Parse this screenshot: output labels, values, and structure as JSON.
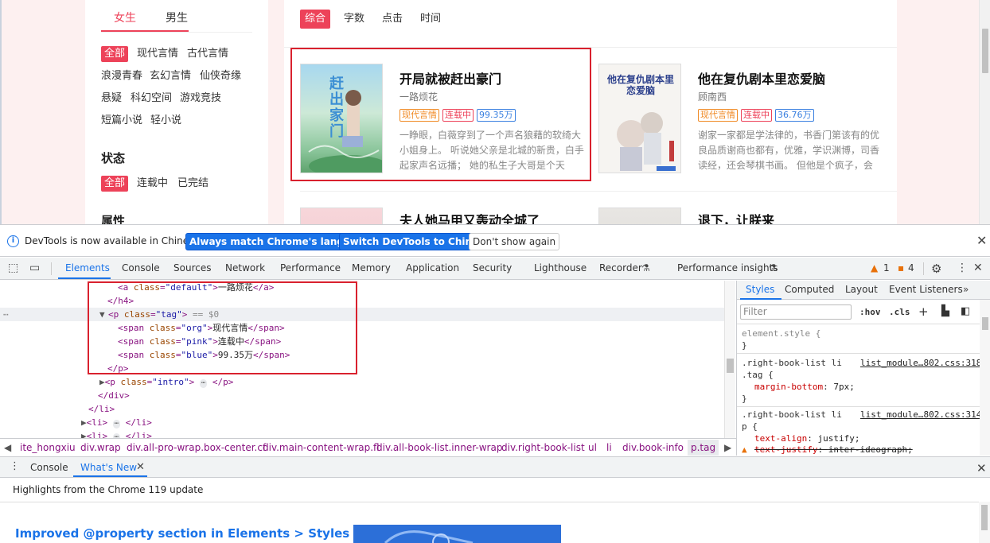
{
  "site": {
    "gender_tabs": [
      "女生",
      "男生"
    ],
    "categories": [
      "全部",
      "现代言情",
      "古代言情",
      "浪漫青春",
      "玄幻言情",
      "仙侠奇缘",
      "悬疑",
      "科幻空间",
      "游戏竞技",
      "短篇小说",
      "轻小说"
    ],
    "status_title": "状态",
    "status_options": [
      "全部",
      "连载中",
      "已完结"
    ],
    "attr_title": "属性",
    "sort_tabs": [
      "综合",
      "字数",
      "点击",
      "时间"
    ],
    "books": [
      {
        "title": "开局就被赶出豪门",
        "author": "一路烦花",
        "tags": [
          "现代言情",
          "连载中",
          "99.35万"
        ],
        "intro": "一睁眼，白薇穿到了一个声名狼藉的软绮大小姐身上。 听说她父亲是北城的新贵，白手起家声名远播； 她的私生子大哥是个天",
        "cover_text": "赶出家门"
      },
      {
        "title": "他在复仇剧本里恋爱脑",
        "author": "顾南西",
        "tags": [
          "现代言情",
          "连载中",
          "36.76万"
        ],
        "intro": "谢家一家都是学法律的，书香门第该有的优良品质谢商也都有，优雅，学识渊博，司香读经，还会琴棋书画。 但他是个疯子，会",
        "cover_text": "他在复仇剧本里恋爱脑"
      },
      {
        "title": "夫人她马甲又轰动全城了"
      },
      {
        "title": "退下，让朕来"
      }
    ]
  },
  "devtools": {
    "infobar": {
      "text": "DevTools is now available in Chinese!",
      "btn_match": "Always match Chrome's language",
      "btn_switch": "Switch DevTools to Chinese",
      "btn_dont": "Don't show again"
    },
    "tabs": [
      "Elements",
      "Console",
      "Sources",
      "Network",
      "Performance",
      "Memory",
      "Application",
      "Security",
      "Lighthouse",
      "Recorder",
      "Performance insights"
    ],
    "warnings": "1",
    "issues": "4",
    "code": {
      "l1_tag": "a",
      "l1_attr": "class",
      "l1_val": "\"default\"",
      "l1_text": "一路烦花",
      "l2": "</h4>",
      "l3_attr": "class",
      "l3_val": "\"tag\"",
      "l3_eq": "== $0",
      "spans": [
        {
          "cls": "\"org\"",
          "text": "现代言情"
        },
        {
          "cls": "\"pink\"",
          "text": "连载中"
        },
        {
          "cls": "\"blue\"",
          "text": "99.35万"
        }
      ],
      "l7": "</p>",
      "l8_val": "\"intro\"",
      "l9": "</div>",
      "l10": "</li>"
    },
    "breadcrumbs": [
      "ite_hongxiu",
      "div.wrap",
      "div.all-pro-wrap.box-center.cf",
      "div.main-content-wrap.fl",
      "div.all-book-list.inner-wrap",
      "div.right-book-list",
      "ul",
      "li",
      "div.book-info",
      "p.tag"
    ],
    "styles": {
      "tabs": [
        "Styles",
        "Computed",
        "Layout",
        "Event Listeners"
      ],
      "filter_placeholder": "Filter",
      "hov": ":hov",
      "cls": ".cls",
      "element_style": "element.style {",
      "close_brace": "}",
      "rule1_selector": ".right-book-list li",
      "rule1_selector2": ".tag {",
      "rule1_source": "list_module…802.css:318",
      "rule1_prop": "margin-bottom",
      "rule1_val": "7px;",
      "rule2_selector": ".right-book-list li",
      "rule2_selector2": "p {",
      "rule2_source": "list_module…802.css:314",
      "rule2_prop": "text-align",
      "rule2_val": "justify;",
      "rule2_prop2": "text-justify",
      "rule2_val2": "inter-ideograph;"
    },
    "drawer": {
      "tabs": [
        "Console",
        "What's New"
      ],
      "highlights": "Highlights from the Chrome 119 update",
      "feature": "Improved @property section in Elements > Styles"
    }
  }
}
